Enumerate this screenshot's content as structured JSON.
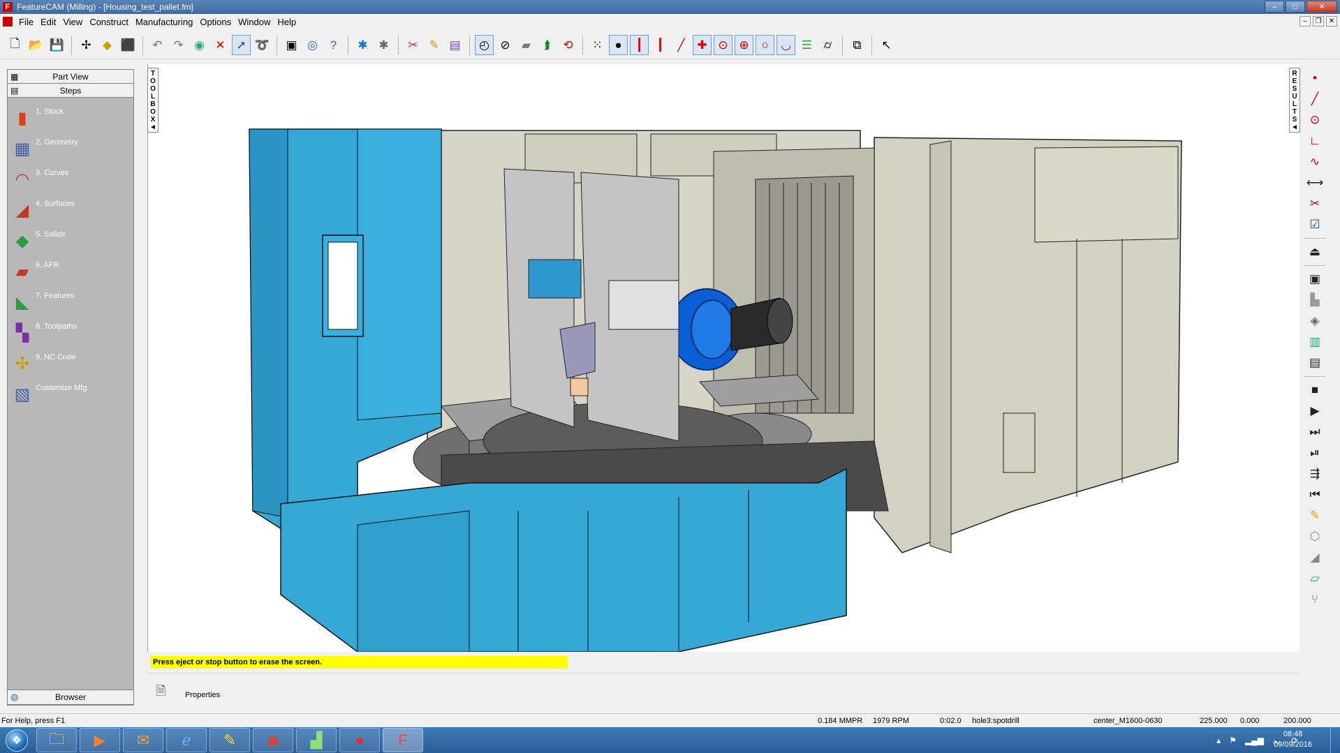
{
  "window": {
    "title": "FeatureCAM (Milling) - [Housing_test_pallet.fm]",
    "minimize": "–",
    "maximize": "□",
    "close": "✕"
  },
  "menu": [
    "File",
    "Edit",
    "View",
    "Construct",
    "Manufacturing",
    "Options",
    "Window",
    "Help"
  ],
  "left_panel": {
    "part_view": "Part View",
    "steps_header": "Steps",
    "steps": [
      {
        "label": "1.  Stock",
        "icon": "stock-icon"
      },
      {
        "label": "2.  Geometry",
        "icon": "geometry-icon"
      },
      {
        "label": "3.  Curves",
        "icon": "curves-icon"
      },
      {
        "label": "4.  Surfaces",
        "icon": "surfaces-icon"
      },
      {
        "label": "5.  Solids",
        "icon": "solids-icon"
      },
      {
        "label": "6.  AFR",
        "icon": "afr-icon"
      },
      {
        "label": "7.  Features",
        "icon": "features-icon"
      },
      {
        "label": "8.  Toolpaths",
        "icon": "toolpaths-icon"
      },
      {
        "label": "9.  NC Code",
        "icon": "nc-code-icon"
      },
      {
        "label": "Customize Mfg.",
        "icon": "customize-mfg-icon"
      }
    ],
    "browser": "Browser"
  },
  "toolbox_letters": [
    "T",
    "O",
    "O",
    "L",
    "B",
    "O",
    "X"
  ],
  "results_letters": [
    "R",
    "E",
    "S",
    "U",
    "L",
    "T",
    "S"
  ],
  "message": "Press eject or stop button to erase the screen.",
  "properties_label": "Properties",
  "status": {
    "help": "For Help, press F1",
    "feed": "0.184 MMPR",
    "speed": "1979 RPM",
    "time": "0:02.0",
    "operation": "hole3:spotdrill",
    "tool": "center_M1600-0630",
    "x": "225.000",
    "y": "0.000",
    "z": "200.000"
  },
  "taskbar": {
    "time": "08:48",
    "date": "09/09/2016"
  },
  "colors": {
    "machine_blue": "#35a8d6",
    "machine_gray": "#cfcfc0",
    "spindle_blue": "#0b5fd6",
    "message_yellow": "#ffff00",
    "panel_gray": "#b8b8b8"
  }
}
